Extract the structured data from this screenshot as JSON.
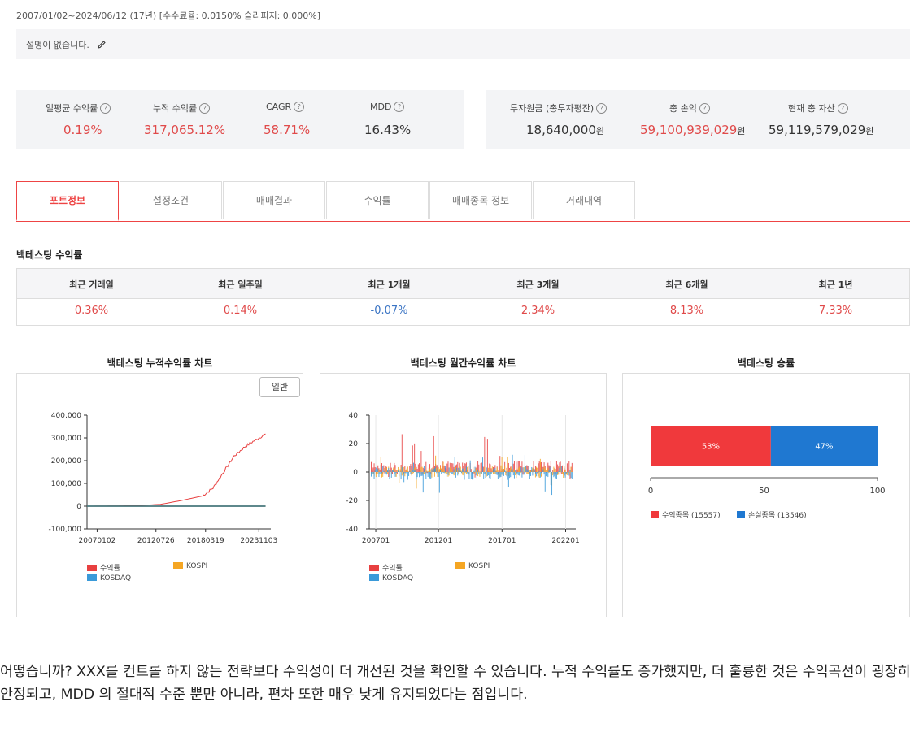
{
  "header": {
    "period": "2007/01/02~2024/06/12 (17년) [수수료율: 0.0150% 슬리피지: 0.000%]",
    "description": "설명이 없습니다."
  },
  "stats_left": [
    {
      "label": "일평균 수익률",
      "value": "0.19%",
      "color": "red"
    },
    {
      "label": "누적 수익률",
      "value": "317,065.12%",
      "color": "red"
    },
    {
      "label": "CAGR",
      "value": "58.71%",
      "color": "red"
    },
    {
      "label": "MDD",
      "value": "16.43%",
      "color": "black"
    }
  ],
  "stats_right": [
    {
      "label": "투자원금 (총투자평잔)",
      "value": "18,640,000",
      "unit": "원",
      "color": "black"
    },
    {
      "label": "총 손익",
      "value": "59,100,939,029",
      "unit": "원",
      "color": "red"
    },
    {
      "label": "현재 총 자산",
      "value": "59,119,579,029",
      "unit": "원",
      "color": "black"
    }
  ],
  "tabs": [
    "포트정보",
    "설정조건",
    "매매결과",
    "수익률",
    "매매종목 정보",
    "거래내역"
  ],
  "returns": {
    "title": "백테스팅 수익률",
    "headers": [
      "최근 거래일",
      "최근 일주일",
      "최근 1개월",
      "최근 3개월",
      "최근 6개월",
      "최근 1년"
    ],
    "values": [
      "0.36%",
      "0.14%",
      "-0.07%",
      "2.34%",
      "8.13%",
      "7.33%"
    ]
  },
  "charts": {
    "cumulative_title": "백테스팅 누적수익률 차트",
    "monthly_title": "백테스팅 월간수익률 차트",
    "winrate_title": "백테스팅 승률",
    "normal_button": "일반"
  },
  "colors": {
    "red": "#e84040",
    "orange": "#f5a623",
    "blue": "#3a9ad9",
    "win": "#f0393c",
    "loss": "#1f78d1"
  },
  "chart_data": [
    {
      "type": "line",
      "title": "백테스팅 누적수익률 차트",
      "x_ticks": [
        "20070102",
        "20120726",
        "20180319",
        "20231103"
      ],
      "ylim": [
        -100000,
        400000
      ],
      "y_ticks": [
        "-100,000",
        "0",
        "100,000",
        "200,000",
        "300,000",
        "400,000"
      ],
      "series": [
        {
          "name": "수익률",
          "x": [
            2007,
            2010,
            2012,
            2014,
            2016,
            2018,
            2019,
            2020,
            2021,
            2022,
            2023,
            2024
          ],
          "y": [
            0,
            1000,
            3000,
            8000,
            25000,
            45000,
            80000,
            150000,
            220000,
            260000,
            290000,
            317000
          ]
        },
        {
          "name": "KOSPI",
          "x": [
            2007,
            2024
          ],
          "y": [
            0,
            0
          ]
        },
        {
          "name": "KOSDAQ",
          "x": [
            2007,
            2024
          ],
          "y": [
            0,
            0
          ]
        }
      ],
      "legend": [
        "수익률",
        "KOSPI",
        "KOSDAQ"
      ]
    },
    {
      "type": "bar",
      "title": "백테스팅 월간수익률 차트",
      "x_ticks": [
        "200701",
        "201201",
        "201701",
        "202201"
      ],
      "ylim": [
        -40,
        40
      ],
      "y_ticks": [
        "-40",
        "-20",
        "0",
        "20",
        "40"
      ],
      "legend": [
        "수익률",
        "KOSPI",
        "KOSDAQ"
      ]
    },
    {
      "type": "bar",
      "title": "백테스팅 승률",
      "xlim": [
        0,
        100
      ],
      "x_ticks": [
        "0",
        "50",
        "100"
      ],
      "segments": [
        {
          "label": "53%",
          "value": 53,
          "legend": "수익종목 (15557)"
        },
        {
          "label": "47%",
          "value": 47,
          "legend": "손실종목 (13546)"
        }
      ]
    }
  ],
  "paragraph": "어떻습니까? XXX를 컨트롤 하지 않는 전략보다 수익성이 더 개선된 것을 확인할 수 있습니다. 누적 수익률도 증가했지만, 더 훌륭한 것은 수익곡선이 굉장히 안정되고, MDD 의 절대적 수준 뿐만 아니라, 편차 또한 매우 낮게 유지되었다는 점입니다."
}
